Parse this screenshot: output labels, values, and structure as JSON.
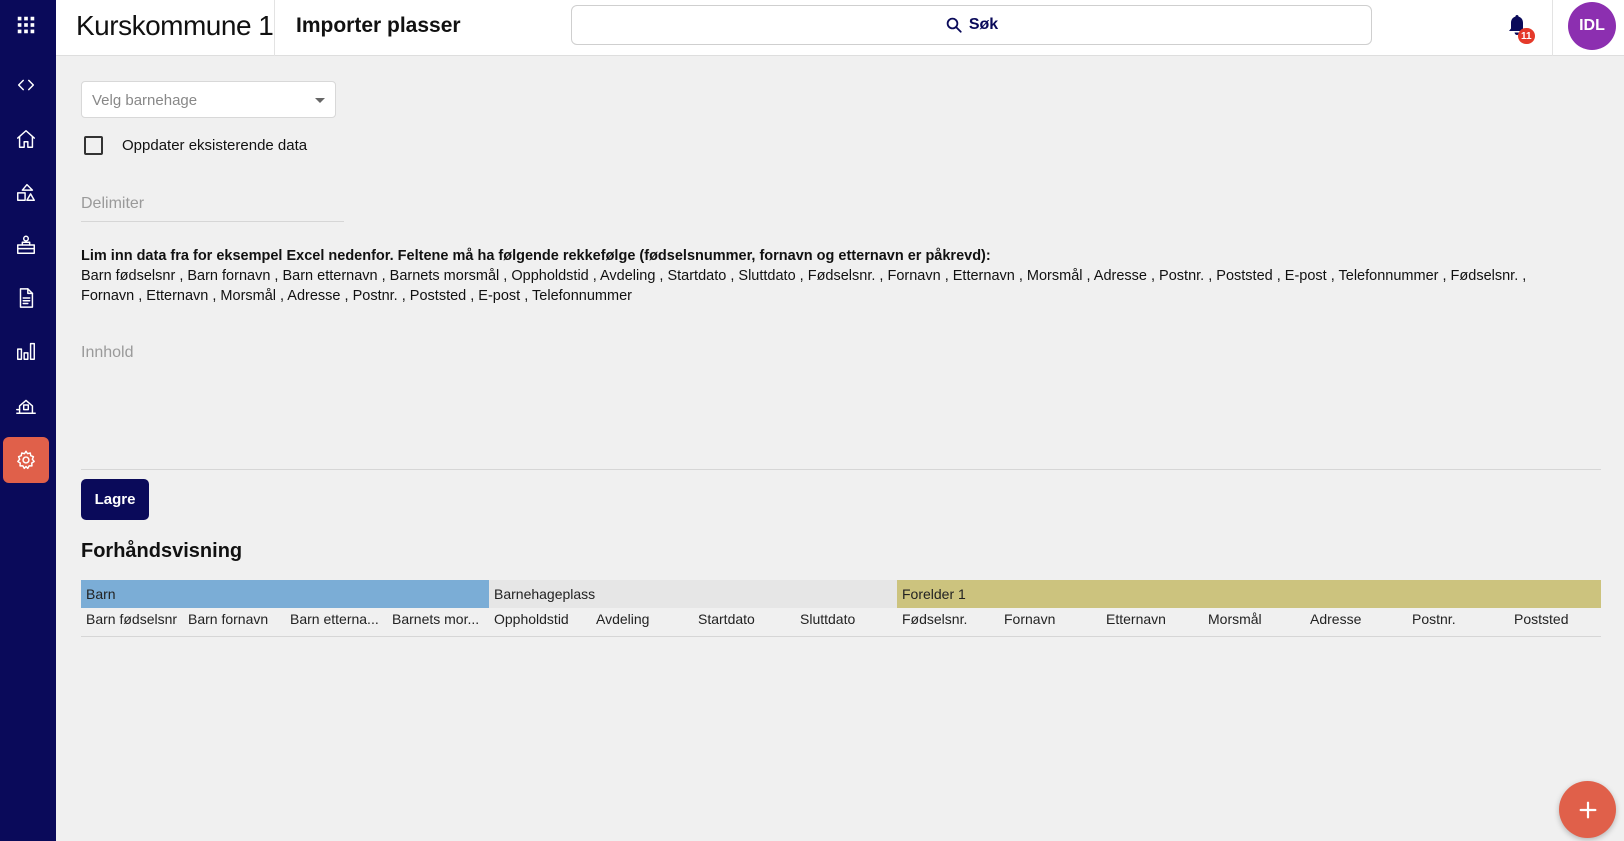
{
  "header": {
    "app_title": "Kurskommune 1",
    "page_title": "Importer plasser",
    "search_label": "Søk",
    "notification_count": "11",
    "avatar_initials": "IDL"
  },
  "nav": {
    "items": [
      {
        "icon": "code-toggle-icon"
      },
      {
        "icon": "home-icon"
      },
      {
        "icon": "shapes-icon"
      },
      {
        "icon": "kindergarten-icon"
      },
      {
        "icon": "document-icon"
      },
      {
        "icon": "bar-chart-icon"
      },
      {
        "icon": "building-icon"
      },
      {
        "icon": "gear-icon",
        "active": true
      }
    ]
  },
  "form": {
    "kindergarten_select_placeholder": "Velg barnehage",
    "update_existing_label": "Oppdater eksisterende data",
    "update_existing_checked": false,
    "delimiter_placeholder": "Delimiter",
    "instructions_title": "Lim inn data fra for eksempel Excel nedenfor. Feltene må ha følgende rekkefølge (fødselsnummer, fornavn og etternavn er påkrevd):",
    "fields_line_1": "Barn fødselsnr ,  Barn fornavn ,  Barn etternavn ,  Barnets morsmål ,  Oppholdstid ,  Avdeling ,  Startdato ,  Sluttdato ,  Fødselsnr. ,  Fornavn ,  Etternavn ,  Morsmål ,  Adresse ,  Postnr. ,  Poststed ,  E-post ,  Telefonnummer ,  Fødselsnr. ,",
    "fields_line_2": "Fornavn ,  Etternavn ,  Morsmål ,  Adresse ,  Postnr. ,  Poststed ,  E-post ,  Telefonnummer",
    "content_placeholder": "Innhold",
    "save_label": "Lagre"
  },
  "preview": {
    "title": "Forhåndsvisning",
    "groups": [
      "Barn",
      "Barnehageplass",
      "Forelder 1"
    ],
    "columns": [
      "Barn fødselsnr",
      "Barn fornavn",
      "Barn etterna...",
      "Barnets mor...",
      "Oppholdstid",
      "Avdeling",
      "Startdato",
      "Sluttdato",
      "Fødselsnr.",
      "Fornavn",
      "Etternavn",
      "Morsmål",
      "Adresse",
      "Postnr.",
      "Poststed"
    ]
  },
  "colors": {
    "nav_bg": "#0a0a5a",
    "accent": "#e0604a",
    "group_barn": "#7badd6",
    "group_plass": "#e6e6e6",
    "group_forelder": "#ccc37e",
    "avatar": "#8c2fb0"
  }
}
